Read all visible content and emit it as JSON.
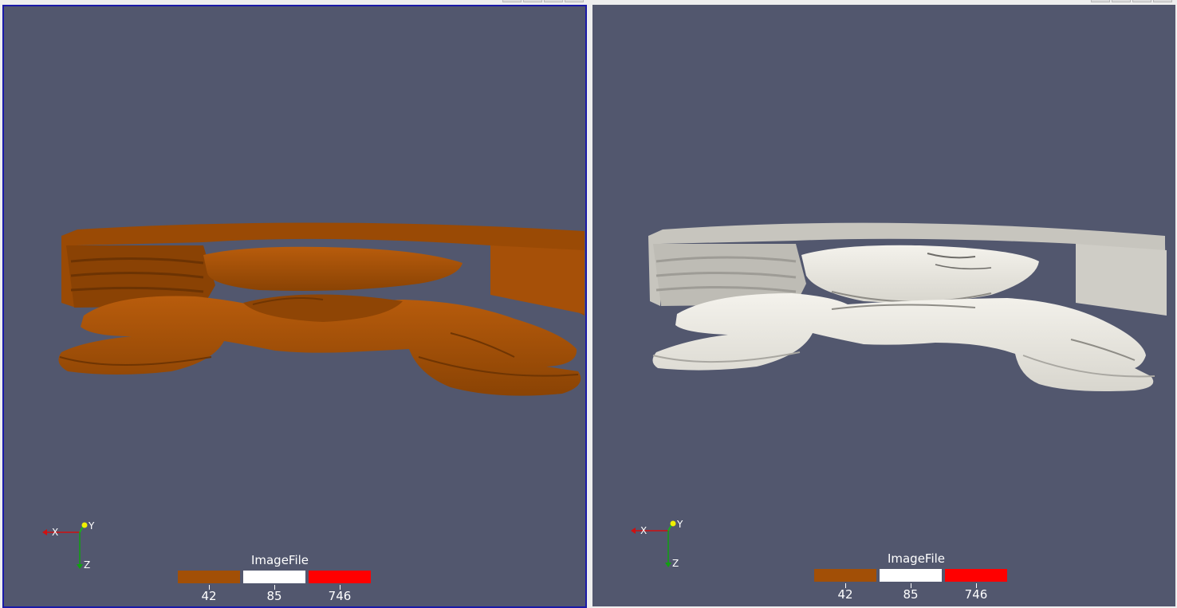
{
  "views": [
    {
      "id": "left",
      "active": true,
      "model_color": "#a24f06",
      "model_shade": "#7a3a04",
      "model_highlight": "#b85c0c",
      "background": "#52576e",
      "axes": {
        "x_label": "X",
        "y_label": "Y",
        "z_label": "Z"
      },
      "scalar_bar": {
        "title": "ImageFile",
        "swatches": [
          "#a24f06",
          "#ffffff",
          "#ff0000"
        ],
        "labels": [
          "42",
          "85",
          "746"
        ]
      }
    },
    {
      "id": "right",
      "active": false,
      "model_color": "#e6e4dc",
      "model_shade": "#b9b7b0",
      "model_highlight": "#f4f2ec",
      "background": "#52576e",
      "axes": {
        "x_label": "X",
        "y_label": "Y",
        "z_label": "Z"
      },
      "scalar_bar": {
        "title": "ImageFile",
        "swatches": [
          "#a24f06",
          "#ffffff",
          "#ff0000"
        ],
        "labels": [
          "42",
          "85",
          "746"
        ]
      }
    }
  ],
  "colors": {
    "active_border": "#1a1aa8",
    "axis_x": "#d01010",
    "axis_y": "#10c010",
    "axis_y_tip": "#f0f000",
    "axis_z": "#10a010"
  }
}
